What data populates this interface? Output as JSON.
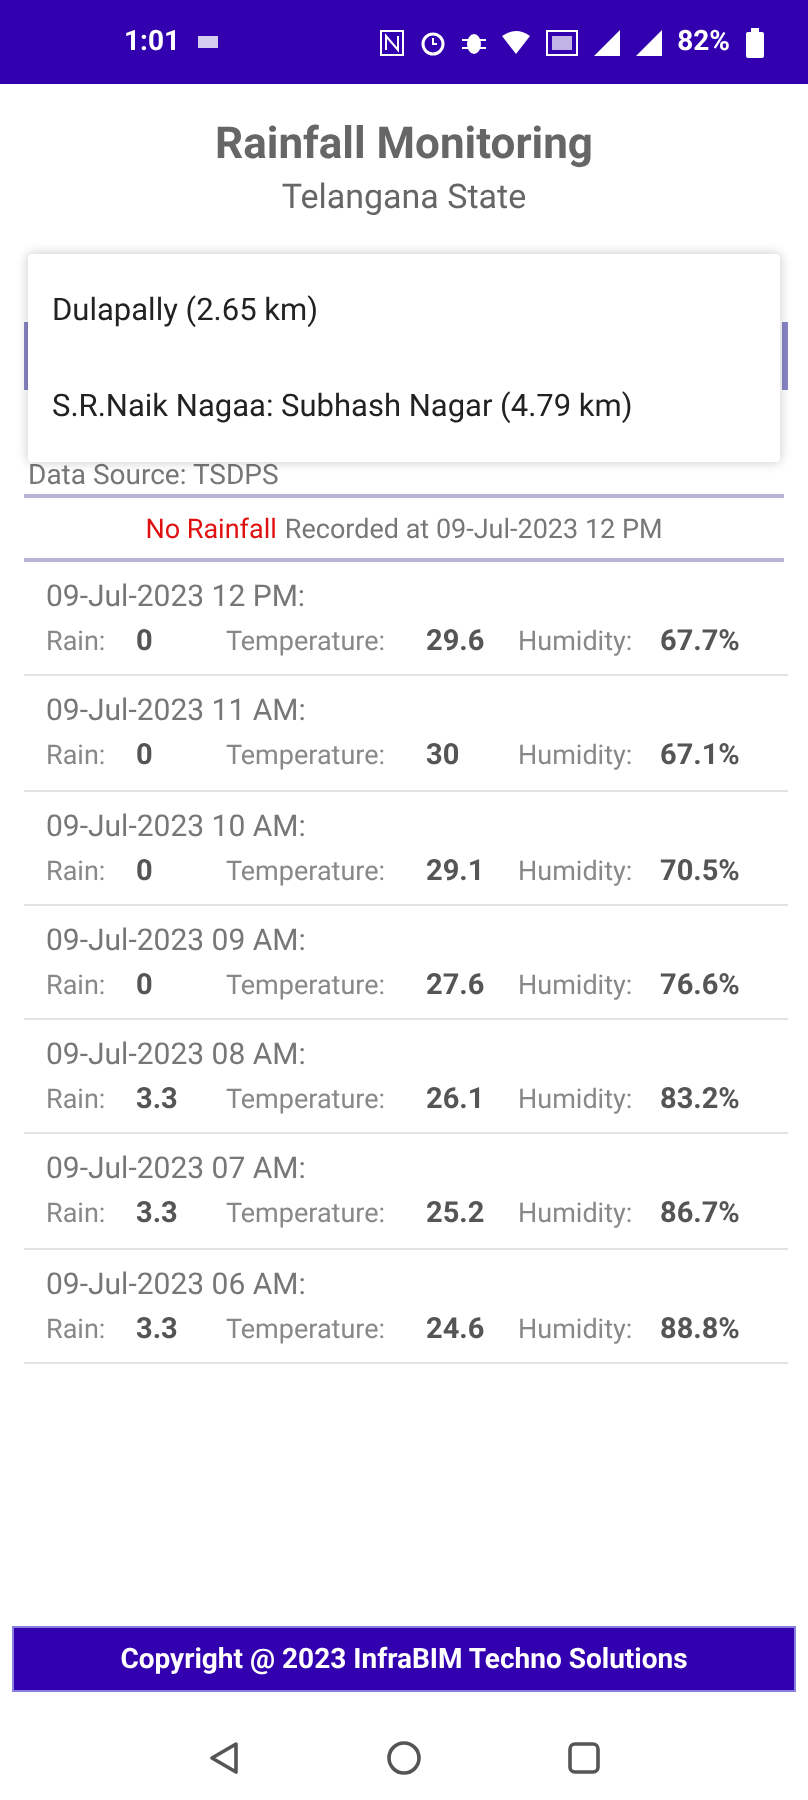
{
  "status_bar": {
    "time": "1:01",
    "battery": "82%"
  },
  "header": {
    "title": "Rainfall Monitoring",
    "subtitle": "Telangana State"
  },
  "location_menu": {
    "options": [
      {
        "label": "Dulapally (2.65 km)"
      },
      {
        "label": "S.R.Naik Nagaa: Subhash Nagar (4.79 km)"
      }
    ]
  },
  "data_source": "Data Source: TSDPS",
  "summary": {
    "status": "No Rainfall",
    "detail": "Recorded at 09-Jul-2023 12 PM"
  },
  "readings": [
    {
      "time": "09-Jul-2023 12 PM:",
      "rain_label": "Rain:",
      "rain": "0",
      "temperature_label": "Temperature:",
      "temperature": "29.6",
      "humidity_label": "Humidity:",
      "humidity": "67.7%"
    },
    {
      "time": "09-Jul-2023 11 AM:",
      "rain_label": "Rain:",
      "rain": "0",
      "temperature_label": "Temperature:",
      "temperature": "30",
      "humidity_label": "Humidity:",
      "humidity": "67.1%"
    },
    {
      "time": "09-Jul-2023 10 AM:",
      "rain_label": "Rain:",
      "rain": "0",
      "temperature_label": "Temperature:",
      "temperature": "29.1",
      "humidity_label": "Humidity:",
      "humidity": "70.5%"
    },
    {
      "time": "09-Jul-2023 09 AM:",
      "rain_label": "Rain:",
      "rain": "0",
      "temperature_label": "Temperature:",
      "temperature": "27.6",
      "humidity_label": "Humidity:",
      "humidity": "76.6%"
    },
    {
      "time": "09-Jul-2023 08 AM:",
      "rain_label": "Rain:",
      "rain": "3.3",
      "temperature_label": "Temperature:",
      "temperature": "26.1",
      "humidity_label": "Humidity:",
      "humidity": "83.2%"
    },
    {
      "time": "09-Jul-2023 07 AM:",
      "rain_label": "Rain:",
      "rain": "3.3",
      "temperature_label": "Temperature:",
      "temperature": "25.2",
      "humidity_label": "Humidity:",
      "humidity": "86.7%"
    },
    {
      "time": "09-Jul-2023 06 AM:",
      "rain_label": "Rain:",
      "rain": "3.3",
      "temperature_label": "Temperature:",
      "temperature": "24.6",
      "humidity_label": "Humidity:",
      "humidity": "88.8%"
    }
  ],
  "footer": "Copyright @ 2023 InfraBIM Techno Solutions"
}
